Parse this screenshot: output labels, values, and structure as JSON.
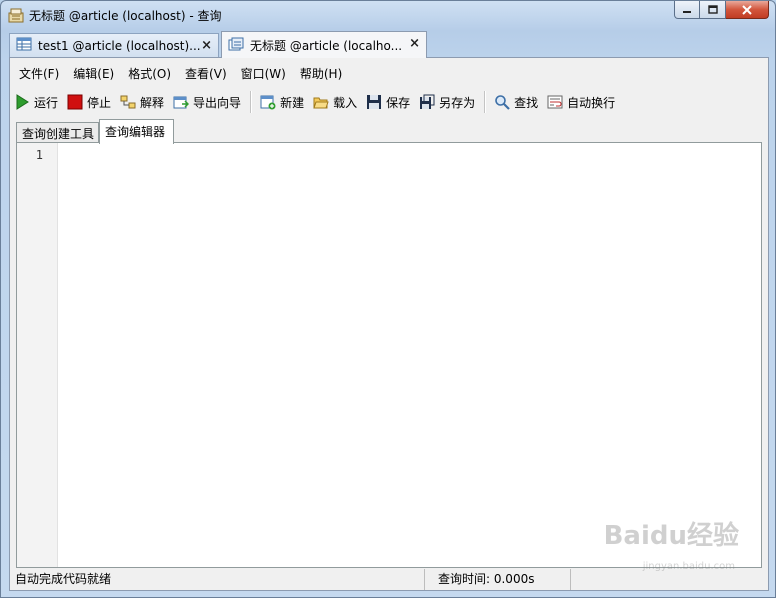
{
  "window": {
    "title": "无标题 @article (localhost) - 查询"
  },
  "doc_tabs": [
    {
      "label": "test1 @article (localhost)...",
      "close": "×",
      "icon": "table-icon",
      "active": false
    },
    {
      "label": "无标题 @article (localho...",
      "close": "×",
      "icon": "query-icon",
      "active": true
    }
  ],
  "menu": [
    {
      "label": "文件(F)"
    },
    {
      "label": "编辑(E)"
    },
    {
      "label": "格式(O)"
    },
    {
      "label": "查看(V)"
    },
    {
      "label": "窗口(W)"
    },
    {
      "label": "帮助(H)"
    }
  ],
  "toolbar": {
    "run": "运行",
    "stop": "停止",
    "explain": "解释",
    "export_wizard": "导出向导",
    "new": "新建",
    "load": "载入",
    "save": "保存",
    "save_as": "另存为",
    "find": "查找",
    "word_wrap": "自动换行"
  },
  "inner_tabs": {
    "builder": "查询创建工具",
    "editor": "查询编辑器"
  },
  "editor": {
    "line_numbers": [
      "1"
    ],
    "content": ""
  },
  "status": {
    "left": "自动完成代码就绪",
    "query_time": "查询时间: 0.000s",
    "right": ""
  },
  "watermark": {
    "logo": "Baidu经验",
    "sub": "jingyan.baidu.com"
  },
  "colors": {
    "run_green": "#2e9d2e",
    "stop_red": "#d01010",
    "titlebar": "#c5d9ef"
  }
}
